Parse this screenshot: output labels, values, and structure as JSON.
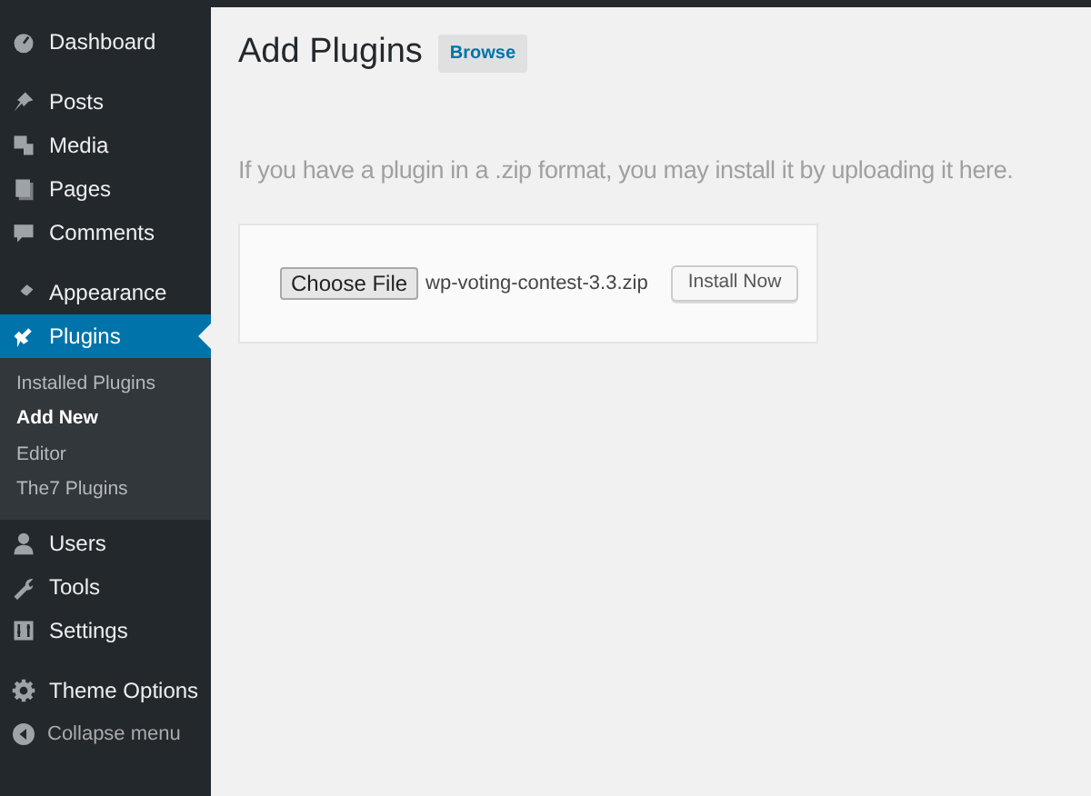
{
  "sidebar": {
    "groups": [
      {
        "items": [
          {
            "label": "Dashboard",
            "selected": false
          }
        ]
      },
      {
        "items": [
          {
            "label": "Posts",
            "selected": false
          },
          {
            "label": "Media",
            "selected": false
          },
          {
            "label": "Pages",
            "selected": false
          },
          {
            "label": "Comments",
            "selected": false
          }
        ]
      },
      {
        "items": [
          {
            "label": "Appearance",
            "selected": false
          },
          {
            "label": "Plugins",
            "selected": true,
            "submenu": [
              {
                "label": "Installed Plugins",
                "selected": false
              },
              {
                "label": "Add New",
                "selected": true
              },
              {
                "label": "Editor",
                "selected": false
              },
              {
                "label": "The7 Plugins",
                "selected": false
              }
            ]
          },
          {
            "label": "Users",
            "selected": false
          },
          {
            "label": "Tools",
            "selected": false
          },
          {
            "label": "Settings",
            "selected": false
          }
        ]
      },
      {
        "items": [
          {
            "label": "Theme Options",
            "selected": false
          }
        ]
      }
    ],
    "collapse": "Collapse menu"
  },
  "page": {
    "title": "Add Plugins",
    "browse_button": "Browse",
    "description": "If you have a plugin in a .zip format, you may install it by uploading it here.",
    "upload": {
      "choose_button": "Choose File",
      "file_name": "wp-voting-contest-3.3.zip",
      "install_button": "Install Now"
    }
  }
}
